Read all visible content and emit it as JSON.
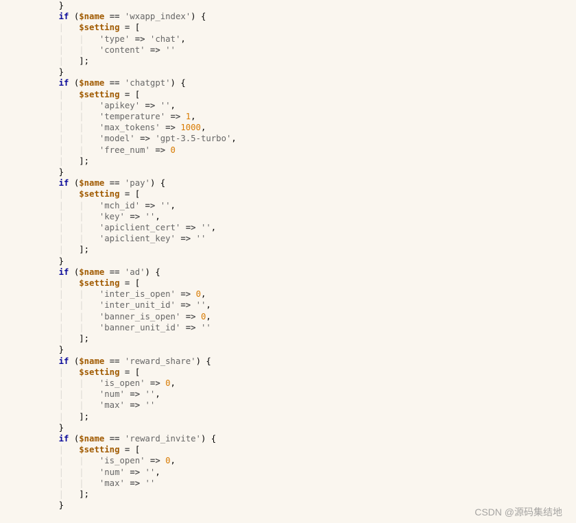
{
  "watermark": "CSDN @源码集结地",
  "kw": {
    "if": "if"
  },
  "var": {
    "name": "$name",
    "setting": "$setting"
  },
  "op": {
    "eq": "==",
    "arrow": "=>",
    "assign": "="
  },
  "pn": {
    "lb": "{",
    "rb": "}",
    "lp": "(",
    "rp": ")",
    "ls": "[",
    "rs": "];",
    "cm": ","
  },
  "blocks": [
    {
      "cond": "'wxapp_index'",
      "items": [
        {
          "key": "'type'",
          "val": "'chat'",
          "type": "str",
          "comma": true
        },
        {
          "key": "'content'",
          "val": "''",
          "type": "str",
          "comma": false
        }
      ]
    },
    {
      "cond": "'chatgpt'",
      "items": [
        {
          "key": "'apikey'",
          "val": "''",
          "type": "str",
          "comma": true
        },
        {
          "key": "'temperature'",
          "val": "1",
          "type": "num",
          "comma": true
        },
        {
          "key": "'max_tokens'",
          "val": "1000",
          "type": "num",
          "comma": true
        },
        {
          "key": "'model'",
          "val": "'gpt-3.5-turbo'",
          "type": "str",
          "comma": true
        },
        {
          "key": "'free_num'",
          "val": "0",
          "type": "num",
          "comma": false
        }
      ]
    },
    {
      "cond": "'pay'",
      "items": [
        {
          "key": "'mch_id'",
          "val": "''",
          "type": "str",
          "comma": true
        },
        {
          "key": "'key'",
          "val": "''",
          "type": "str",
          "comma": true
        },
        {
          "key": "'apiclient_cert'",
          "val": "''",
          "type": "str",
          "comma": true
        },
        {
          "key": "'apiclient_key'",
          "val": "''",
          "type": "str",
          "comma": false
        }
      ]
    },
    {
      "cond": "'ad'",
      "items": [
        {
          "key": "'inter_is_open'",
          "val": "0",
          "type": "num",
          "comma": true
        },
        {
          "key": "'inter_unit_id'",
          "val": "''",
          "type": "str",
          "comma": true
        },
        {
          "key": "'banner_is_open'",
          "val": "0",
          "type": "num",
          "comma": true
        },
        {
          "key": "'banner_unit_id'",
          "val": "''",
          "type": "str",
          "comma": false
        }
      ]
    },
    {
      "cond": "'reward_share'",
      "items": [
        {
          "key": "'is_open'",
          "val": "0",
          "type": "num",
          "comma": true
        },
        {
          "key": "'num'",
          "val": "''",
          "type": "str",
          "comma": true
        },
        {
          "key": "'max'",
          "val": "''",
          "type": "str",
          "comma": false
        }
      ]
    },
    {
      "cond": "'reward_invite'",
      "items": [
        {
          "key": "'is_open'",
          "val": "0",
          "type": "num",
          "comma": true
        },
        {
          "key": "'num'",
          "val": "''",
          "type": "str",
          "comma": true
        },
        {
          "key": "'max'",
          "val": "''",
          "type": "str",
          "comma": false
        }
      ]
    }
  ]
}
